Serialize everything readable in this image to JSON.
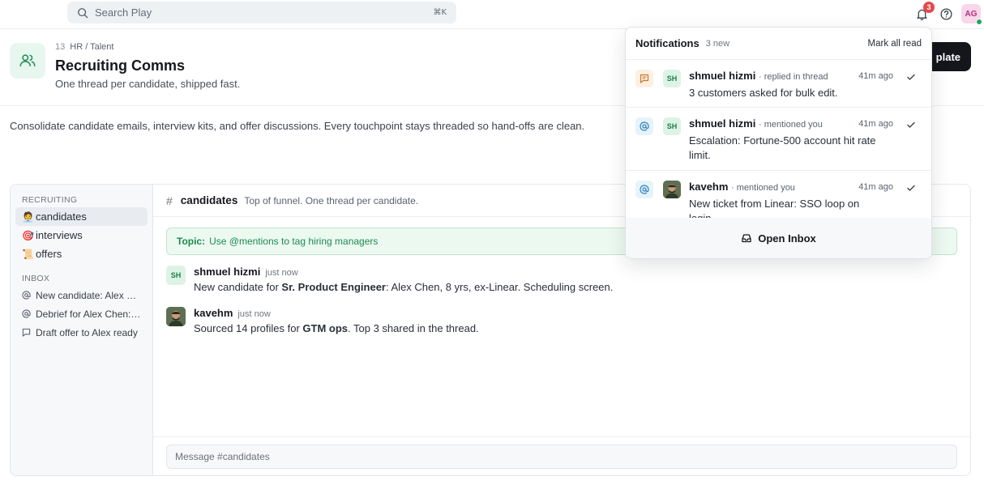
{
  "topbar": {
    "search_placeholder": "Search Play",
    "search_shortcut": "⌘K",
    "notif_count": "3",
    "user_initials": "AG"
  },
  "header": {
    "index": "13",
    "breadcrumb": "HR / Talent",
    "title": "Recruiting Comms",
    "subtitle": "One thread per candidate, shipped fast.",
    "cta_label": "plate"
  },
  "description": "Consolidate candidate emails, interview kits, and offer discussions. Every touchpoint stays threaded so hand-offs are clean.",
  "sidebar": {
    "section_recruiting": "RECRUITING",
    "channels": [
      {
        "emoji": "🧑‍💼",
        "label": "candidates"
      },
      {
        "emoji": "🎯",
        "label": "interviews"
      },
      {
        "emoji": "📜",
        "label": "offers"
      }
    ],
    "section_inbox": "INBOX",
    "inbox": [
      {
        "icon": "at-icon",
        "label": "New candidate: Alex Chen"
      },
      {
        "icon": "at-icon",
        "label": "Debrief for Alex Chen: strong"
      },
      {
        "icon": "chat-icon",
        "label": "Draft offer to Alex ready"
      }
    ]
  },
  "channel": {
    "hash": "#",
    "name": "candidates",
    "purpose": "Top of funnel. One thread per candidate.",
    "topic_label": "Topic:",
    "topic_text": "Use @mentions to tag hiring managers",
    "messages": [
      {
        "initials": "SH",
        "author": "shmuel hizmi",
        "time": "just now",
        "text_pre": "New candidate for ",
        "text_bold": "Sr. Product Engineer",
        "text_post": ": Alex Chen, 8 yrs, ex-Linear. Scheduling screen."
      },
      {
        "initials": "",
        "author": "kavehm",
        "time": "just now",
        "text_pre": "Sourced 14 profiles for ",
        "text_bold": "GTM ops",
        "text_post": ". Top 3 shared in the thread."
      }
    ],
    "composer_placeholder": "Message #candidates"
  },
  "notifications": {
    "title": "Notifications",
    "new_count": "3 new",
    "mark_all": "Mark all read",
    "items": [
      {
        "kind": "reply-icon",
        "initials": "SH",
        "who": "shmuel hizmi",
        "action": "· replied in thread",
        "body": "3 customers asked for bulk edit.",
        "ago": "41m ago"
      },
      {
        "kind": "at-icon",
        "initials": "SH",
        "who": "shmuel hizmi",
        "action": "· mentioned you",
        "body": "Escalation: Fortune-500 account hit rate limit.",
        "ago": "41m ago"
      },
      {
        "kind": "at-icon",
        "initials": "",
        "who": "kavehm",
        "action": "· mentioned you",
        "body": "New ticket from Linear: SSO loop on login.",
        "ago": "41m ago"
      }
    ],
    "footer": "Open Inbox"
  },
  "colors": {
    "accent_green": "#1d8a50",
    "badge_red": "#e5484d",
    "cta_dark": "#14161b"
  }
}
